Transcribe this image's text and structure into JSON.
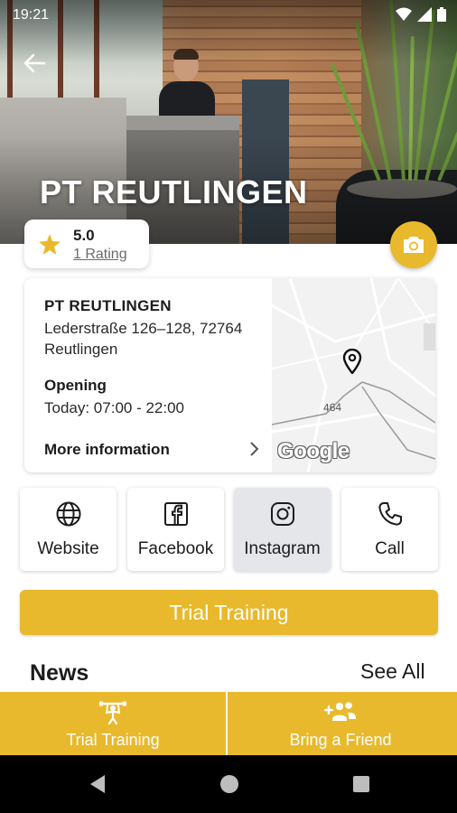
{
  "status_bar": {
    "time": "19:21"
  },
  "hero": {
    "title": "PT REUTLINGEN"
  },
  "rating": {
    "score": "5.0",
    "count": "1 Rating"
  },
  "studio": {
    "name": "PT REUTLINGEN",
    "address": "Lederstraße 126–128, 72764 Reutlingen",
    "opening_label": "Opening",
    "opening_value": "Today: 07:00 - 22:00",
    "more_info": "More information"
  },
  "map": {
    "road_label": "464",
    "attribution": "Google"
  },
  "actions": [
    {
      "label": "Website",
      "icon": "globe-icon"
    },
    {
      "label": "Facebook",
      "icon": "facebook-icon"
    },
    {
      "label": "Instagram",
      "icon": "instagram-icon"
    },
    {
      "label": "Call",
      "icon": "phone-icon"
    }
  ],
  "trial_button": "Trial Training",
  "news": {
    "title": "News",
    "see_all": "See All"
  },
  "bottom_tabs": [
    {
      "label": "Trial Training",
      "icon": "trial-training-icon"
    },
    {
      "label": "Bring a Friend",
      "icon": "add-group-icon"
    }
  ],
  "colors": {
    "accent": "#e8b92c",
    "star": "#e8b92c",
    "active_action_bg": "#e4e6ea"
  }
}
